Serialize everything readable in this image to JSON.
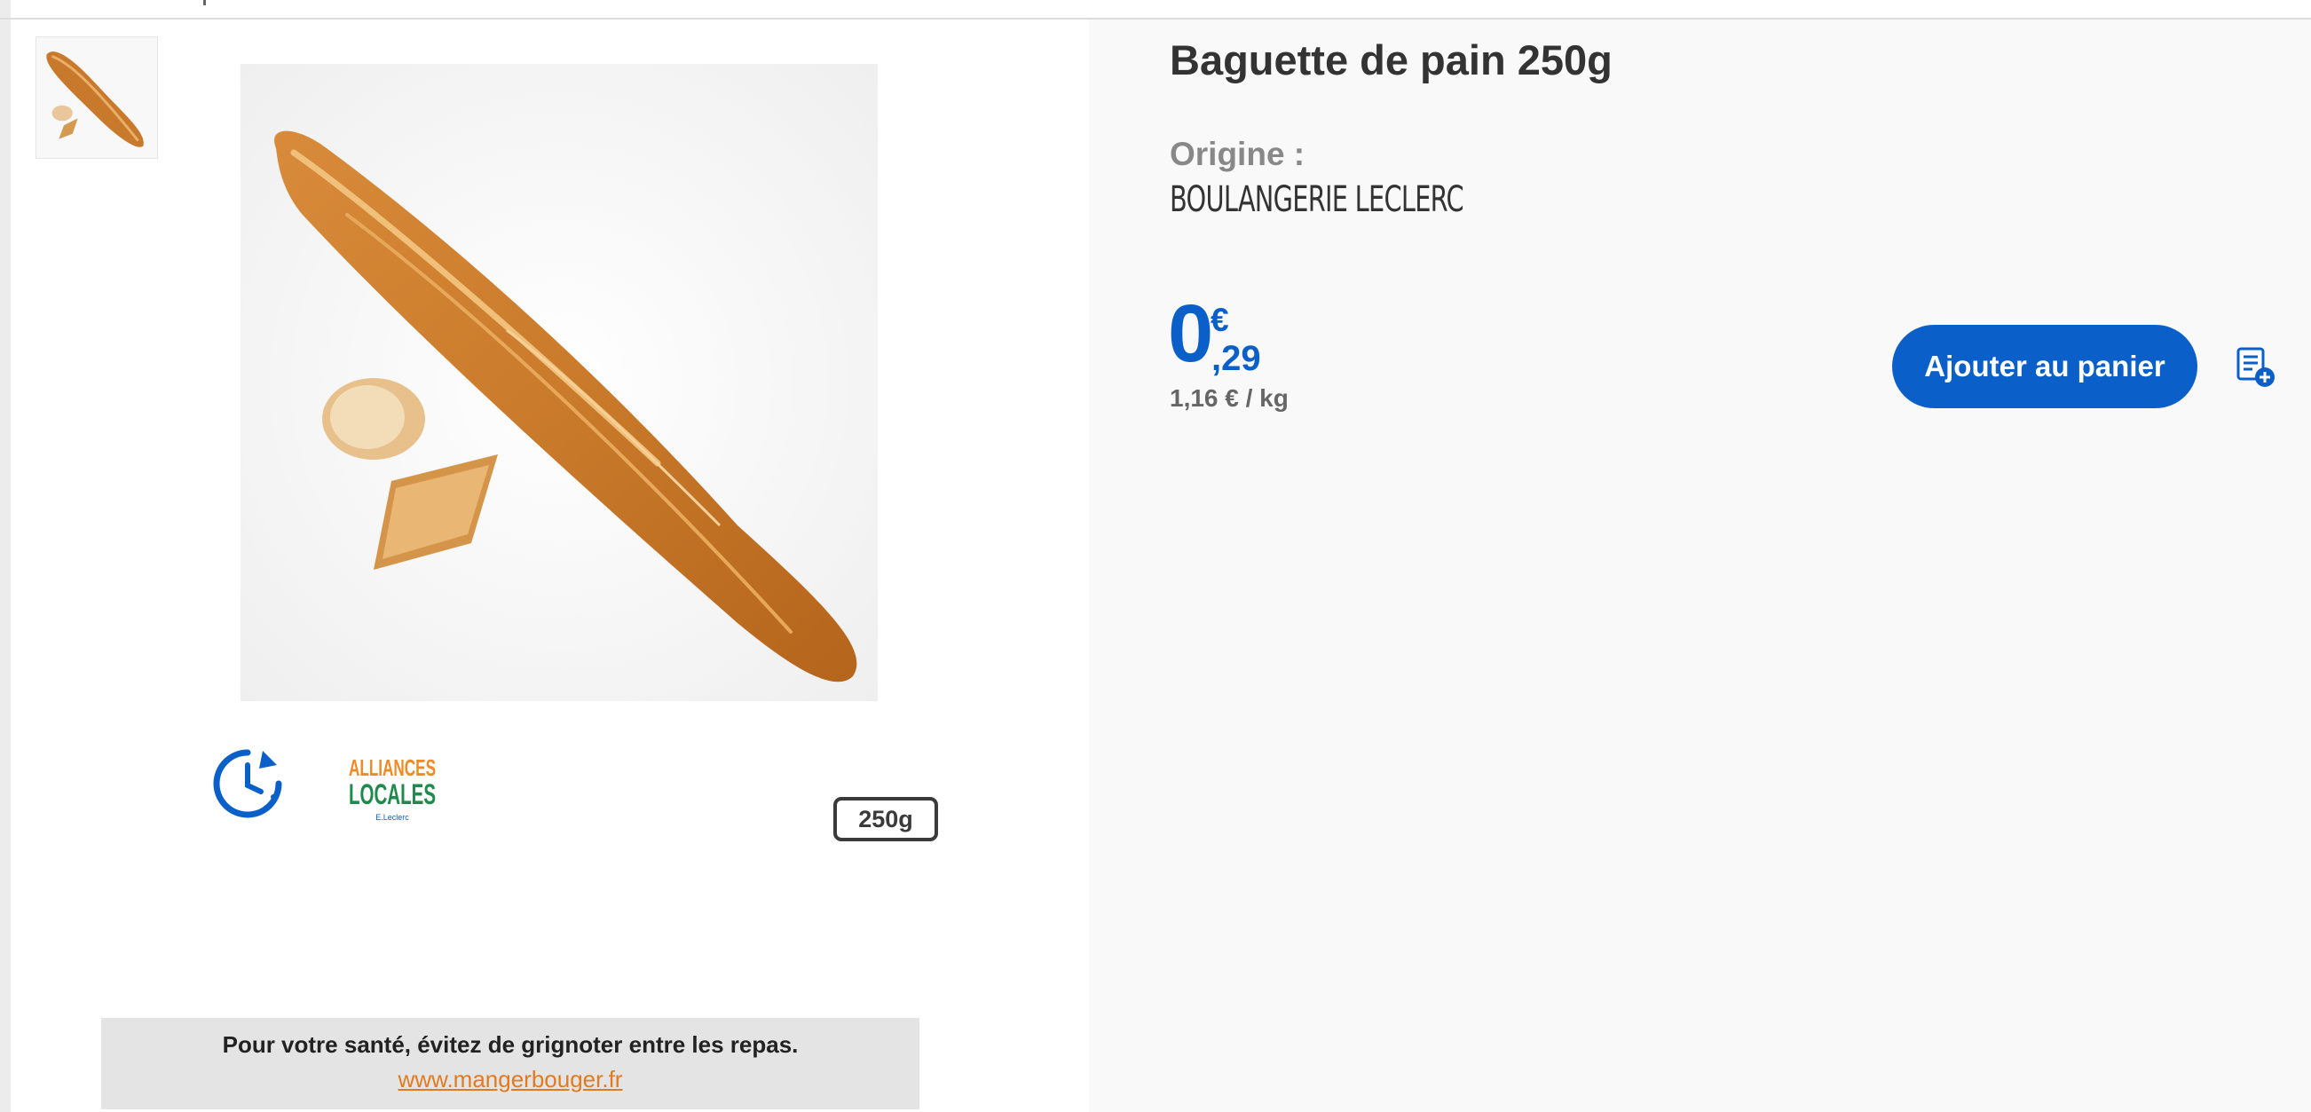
{
  "product": {
    "title": "Baguette de pain 250g",
    "origin_label": "Origine :",
    "origin_value": "BOULANGERIE LECLERC"
  },
  "price": {
    "integer": "0",
    "currency": "€",
    "decimals": ",29",
    "unit_price": "1,16 € / kg"
  },
  "actions": {
    "add_to_cart_label": "Ajouter au panier",
    "shopping_list_icon": "list-add-icon"
  },
  "badges": {
    "clock_icon": "clock-refresh-icon",
    "alliances_line1": "ALLIANCES",
    "alliances_line2": "LOCALES",
    "alliances_sub": "E.Leclerc",
    "weight": "250g"
  },
  "health": {
    "message": "Pour votre santé, évitez de grignoter entre les repas.",
    "link": "www.mangerbouger.fr"
  },
  "colors": {
    "brand_blue": "#0a5fc9",
    "link_orange": "#e07b1f",
    "alliances_orange": "#f08a24",
    "alliances_green": "#1f8a4c"
  }
}
